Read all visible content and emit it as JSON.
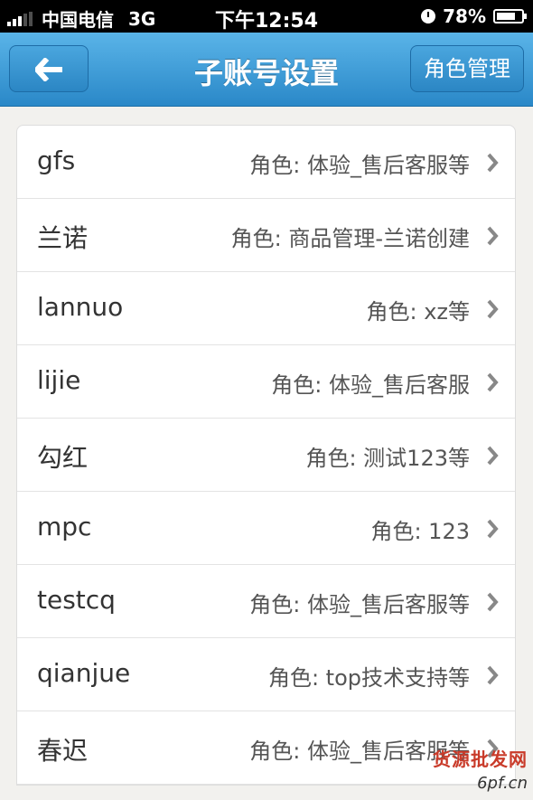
{
  "status_bar": {
    "carrier": "中国电信",
    "network": "3G",
    "time": "下午12:54",
    "battery": "78%",
    "battery_level": 0.78
  },
  "navbar": {
    "title": "子账号设置",
    "role_button": "角色管理"
  },
  "accounts": [
    {
      "name": "gfs",
      "role": "角色: 体验_售后客服等"
    },
    {
      "name": "兰诺",
      "role": "角色: 商品管理-兰诺创建"
    },
    {
      "name": "lannuo",
      "role": "角色: xz等"
    },
    {
      "name": "lijie",
      "role": "角色: 体验_售后客服"
    },
    {
      "name": "勾红",
      "role": "角色: 测试123等"
    },
    {
      "name": "mpc",
      "role": "角色: 123"
    },
    {
      "name": "testcq",
      "role": "角色: 体验_售后客服等"
    },
    {
      "name": "qianjue",
      "role": "角色: top技术支持等"
    },
    {
      "name": "春迟",
      "role": "角色: 体验_售后客服等"
    }
  ],
  "watermark": {
    "text": "货源批发网",
    "site": "6pf.cn"
  }
}
